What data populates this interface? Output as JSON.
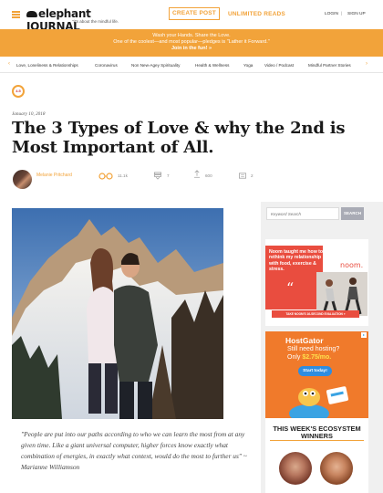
{
  "header": {
    "logo_text": "elephant JOURNAL",
    "logo_tagline": "\"it's about the mindful life.",
    "create_post": "CREATE POST",
    "unlimited_reads": "UNLIMITED READS",
    "login": "LOGIN",
    "separator": "|",
    "sign_up": "SIGN UP"
  },
  "banner": {
    "line1": "Wash your Hands. Share the Love.",
    "line2": "One of the coolest—and most popular—pledges is \"Lather it Forward.\"",
    "line3": "Join in the fun! »"
  },
  "categories": {
    "prev_arrow": "‹",
    "next_arrow": "›",
    "items": [
      "Love, Loneliness & Relationships",
      "Coronavirus",
      "Non New-Agey Spirituality",
      "Health & Wellness",
      "Yoga",
      "Video / Podcast",
      "Mindful Partner Stories"
    ]
  },
  "article": {
    "badge": "4.5",
    "date": "January 10, 2018",
    "title": "The 3 Types of Love & why the 2nd is Most Important of All.",
    "author": "Melanie Pritchard",
    "reads": "11.1k",
    "comments": "7",
    "hearts": "600",
    "shares": "2",
    "quote": "\"People are put into our paths according to who we can learn the most from at any given time. Like a giant universal computer, higher forces know exactly what combination of energies, in exactly what context, would do the most to further us\" ~ Marianne Williamson"
  },
  "sidebar": {
    "search_placeholder": "Keyword Search",
    "search_button": "SEARCH",
    "noom_ad": {
      "text": "Noom taught me how to rethink my relationship with food, exercise & stress.",
      "logo": "noom.",
      "cta": "TAKE NOOM'S 16-SECOND EVALUATION »"
    },
    "hostgator_ad": {
      "brand": "HostGator",
      "line2": "Still need hosting?",
      "line3_prefix": "Only ",
      "price": "$2.75/mo.",
      "cta": "Start today!"
    },
    "ecosystem_title": "THIS WEEK'S ECOSYSTEM WINNERS"
  },
  "colors": {
    "brand_orange": "#f2a33a",
    "noom_red": "#e94d3f",
    "hostgator_orange": "#f07a2b",
    "hostgator_blue": "#2e8de0"
  }
}
